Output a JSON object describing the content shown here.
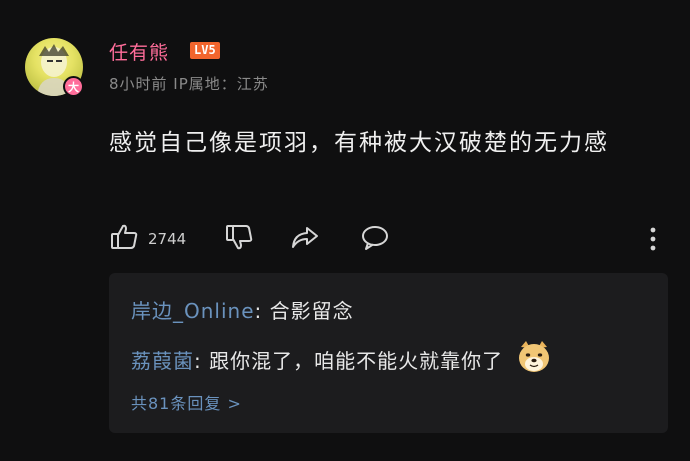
{
  "comment": {
    "avatar_badge": "大",
    "username": "任有熊",
    "level": "LV5",
    "meta": "8小时前 IP属地：江苏",
    "text": "感觉自己像是项羽，有种被大汉破楚的无力感",
    "like_count": "2744",
    "icons": [
      "thumbs-up-icon",
      "thumbs-down-icon",
      "share-icon",
      "reply-icon",
      "more-icon"
    ]
  },
  "replies": {
    "items": [
      {
        "author": "岸边_Online",
        "separator": ": ",
        "text": "合影留念",
        "emoji": ""
      },
      {
        "author": "荔葭菌",
        "separator": ": ",
        "text": "跟你混了，咱能不能火就靠你了",
        "emoji": "doge-emoji"
      }
    ],
    "view_all": "共81条回复 >"
  },
  "colors": {
    "background": "#0f0f10",
    "username": "#ff6d9a",
    "level_badge": "#f2652d",
    "reply_author": "#6a92bd",
    "reply_box": "#1c1c1e"
  }
}
